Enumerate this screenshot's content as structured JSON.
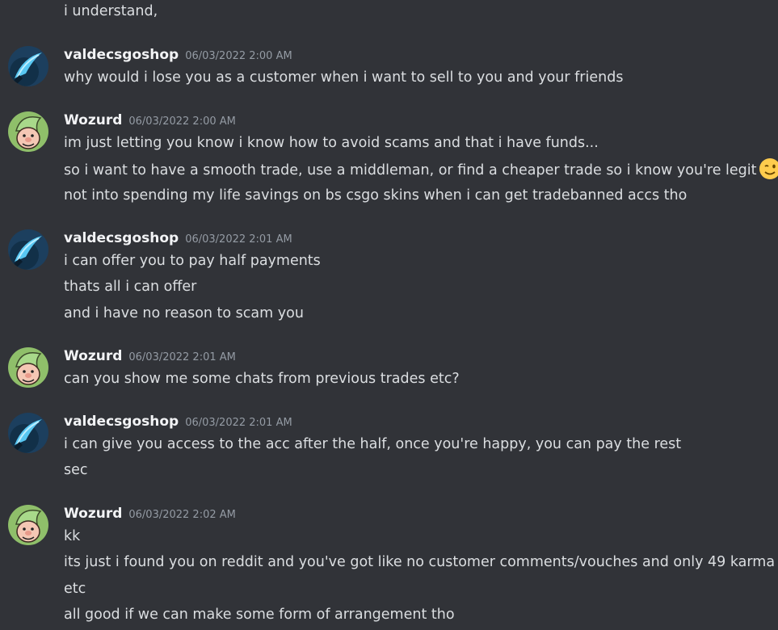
{
  "messages": [
    {
      "author": "",
      "timestamp": "",
      "lines": [
        "i understand,"
      ]
    },
    {
      "author": "valdecsgoshop",
      "avatar": "knife-avatar",
      "timestamp": "06/03/2022 2:00 AM",
      "lines": [
        "why would i lose you as a customer when i want to sell to you and your friends"
      ]
    },
    {
      "author": "Wozurd",
      "avatar": "elf-avatar",
      "timestamp": "06/03/2022 2:00 AM",
      "lines": [
        "im just letting you know i know how to avoid scams and that i have funds...",
        "so i want to have a smooth trade, use a middleman, or find a cheaper trade so i know you're legit",
        "not into spending my life savings on bs csgo skins when i can get tradebanned accs tho"
      ]
    },
    {
      "author": "valdecsgoshop",
      "avatar": "knife-avatar",
      "timestamp": "06/03/2022 2:01 AM",
      "lines": [
        "i can offer you to pay half payments",
        "thats all i can offer",
        "and i have no reason to scam you"
      ]
    },
    {
      "author": "Wozurd",
      "avatar": "elf-avatar",
      "timestamp": "06/03/2022 2:01 AM",
      "lines": [
        "can you show me some chats from previous trades etc?"
      ]
    },
    {
      "author": "valdecsgoshop",
      "avatar": "knife-avatar",
      "timestamp": "06/03/2022 2:01 AM",
      "lines": [
        "i can give you access to the acc after the half, once you're happy, you can pay the rest",
        "sec"
      ]
    },
    {
      "author": "Wozurd",
      "avatar": "elf-avatar",
      "timestamp": "06/03/2022 2:02 AM",
      "lines": [
        "kk",
        "its just i found you on reddit and you've got like no customer comments/vouches and only 49 karma",
        "etc",
        "all good if we can make some form of arrangement tho"
      ]
    }
  ],
  "emoji": {
    "name": "winking-face-emoji"
  },
  "colors": {
    "background": "#313338",
    "text": "#dbdee1",
    "username": "#f2f3f5",
    "timestamp": "#949ba4"
  }
}
